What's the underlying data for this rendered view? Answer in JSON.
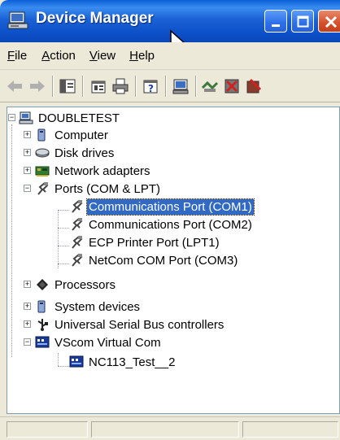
{
  "window": {
    "title": "Device Manager",
    "title_icon": "computer-icon",
    "buttons": [
      "minimize",
      "maximize",
      "close"
    ]
  },
  "menu": {
    "items": [
      {
        "label": "File",
        "mnemonic": "F",
        "rest": "ile"
      },
      {
        "label": "Action",
        "mnemonic": "A",
        "rest": "ction"
      },
      {
        "label": "View",
        "mnemonic": "V",
        "rest": "iew"
      },
      {
        "label": "Help",
        "mnemonic": "H",
        "rest": "elp"
      }
    ]
  },
  "toolbar": {
    "icons": [
      "back-arrow-icon",
      "forward-arrow-icon",
      "show-hide-tree-icon",
      "properties-icon",
      "print-icon",
      "help-icon",
      "scan-hardware-icon",
      "update-driver-icon",
      "uninstall-icon",
      "disable-icon"
    ]
  },
  "tree": {
    "root": "DOUBLETEST",
    "items": [
      {
        "label": "Computer",
        "icon": "computer-icon",
        "expanded": false
      },
      {
        "label": "Disk drives",
        "icon": "disk-drive-icon",
        "expanded": false
      },
      {
        "label": "Network adapters",
        "icon": "network-adapter-icon",
        "expanded": false
      },
      {
        "label": "Ports (COM & LPT)",
        "icon": "port-icon",
        "expanded": true
      },
      {
        "label": "Communications Port (COM1)",
        "icon": "port-icon",
        "selected": true
      },
      {
        "label": "Communications Port (COM2)",
        "icon": "port-icon"
      },
      {
        "label": "ECP Printer Port (LPT1)",
        "icon": "port-icon"
      },
      {
        "label": "NetCom COM Port (COM3)",
        "icon": "port-icon"
      },
      {
        "label": "Processors",
        "icon": "processor-icon",
        "expanded": false
      },
      {
        "label": "System devices",
        "icon": "system-devices-icon",
        "expanded": false
      },
      {
        "label": "Universal Serial Bus controllers",
        "icon": "usb-icon",
        "expanded": false
      },
      {
        "label": "VScom Virtual Com",
        "icon": "virtual-com-icon",
        "expanded": true
      },
      {
        "label": "NC113_Test__2",
        "icon": "virtual-com-icon"
      }
    ]
  },
  "colors": {
    "titlebar": "#0c4fc6",
    "selection": "#316ac5",
    "window_bg": "#ece9d8"
  }
}
